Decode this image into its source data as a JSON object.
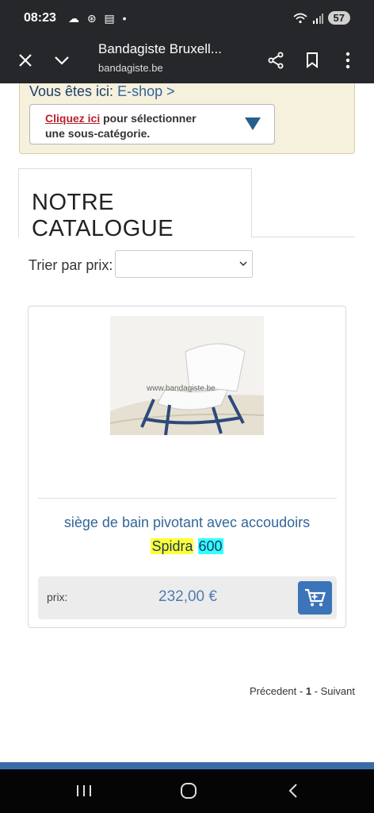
{
  "status": {
    "time": "08:23",
    "left_icons": "☁ ⊛ ▤ •",
    "battery": "57"
  },
  "browser": {
    "title": "Bandagiste Bruxell...",
    "url": "bandagiste.be"
  },
  "breadcrumb": {
    "prefix": "Vous êtes ici: ",
    "current": "E-shop >"
  },
  "subcategory": {
    "link": "Cliquez ici",
    "text_1": " pour sélectionner",
    "text_2": "une sous-catégorie."
  },
  "catalog": {
    "title": "NOTRE CATALOGUE"
  },
  "sort": {
    "label": "Trier par prix:",
    "selected": ""
  },
  "product": {
    "image_watermark": "www.bandagiste.be",
    "name": "siège de bain pivotant avec accoudoirs",
    "brand": "Spidra",
    "model": "600",
    "price_label": "prix:",
    "price": "232,00 €"
  },
  "pagination": {
    "prev": "Précedent - ",
    "current": "1",
    "next": " - Suivant"
  },
  "colors": {
    "accent": "#336699",
    "cart": "#3b74b8",
    "breadcrumb_bg": "#f6f1dd",
    "highlight_yellow": "#ffff33",
    "highlight_cyan": "#33ffff"
  }
}
